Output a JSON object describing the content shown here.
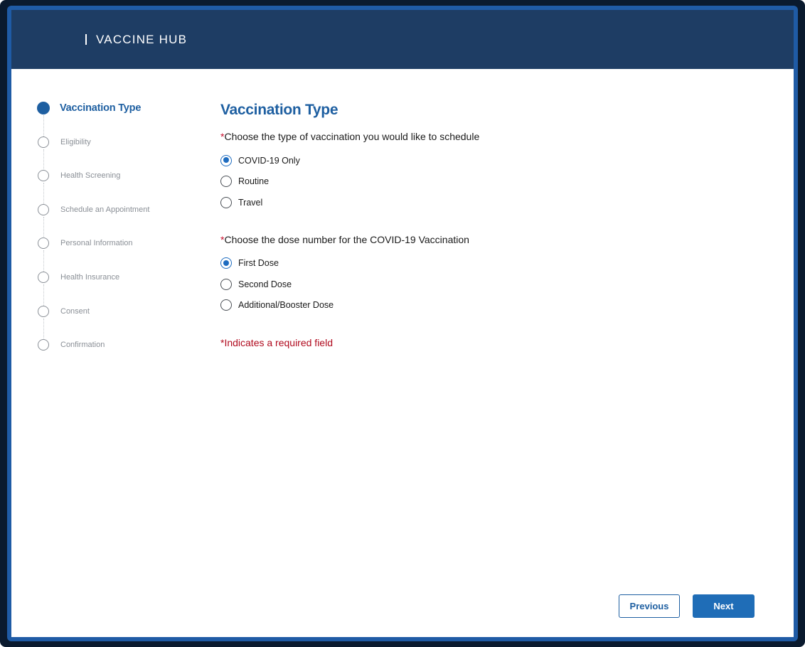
{
  "header": {
    "brand": "VACCINE HUB"
  },
  "stepper": {
    "steps": [
      {
        "label": "Vaccination Type",
        "active": true
      },
      {
        "label": "Eligibility",
        "active": false
      },
      {
        "label": "Health Screening",
        "active": false
      },
      {
        "label": "Schedule an Appointment",
        "active": false
      },
      {
        "label": "Personal Information",
        "active": false
      },
      {
        "label": "Health Insurance",
        "active": false
      },
      {
        "label": "Consent",
        "active": false
      },
      {
        "label": "Confirmation",
        "active": false
      }
    ]
  },
  "main": {
    "title": "Vaccination Type",
    "q1": {
      "required_mark": "*",
      "text": "Choose the type of vaccination you would like to schedule",
      "options": [
        {
          "label": "COVID-19 Only",
          "selected": true
        },
        {
          "label": "Routine",
          "selected": false
        },
        {
          "label": "Travel",
          "selected": false
        }
      ]
    },
    "q2": {
      "required_mark": "*",
      "text": "Choose the dose number for the COVID-19 Vaccination",
      "options": [
        {
          "label": "First Dose",
          "selected": true
        },
        {
          "label": "Second Dose",
          "selected": false
        },
        {
          "label": "Additional/Booster Dose",
          "selected": false
        }
      ]
    },
    "required_note": "*Indicates a required field"
  },
  "footer": {
    "previous_label": "Previous",
    "next_label": "Next"
  },
  "colors": {
    "header_bg": "#1e3d64",
    "accent": "#1e5fa1",
    "radio_selected": "#1e6cc0",
    "required_red": "#b00a1e"
  }
}
